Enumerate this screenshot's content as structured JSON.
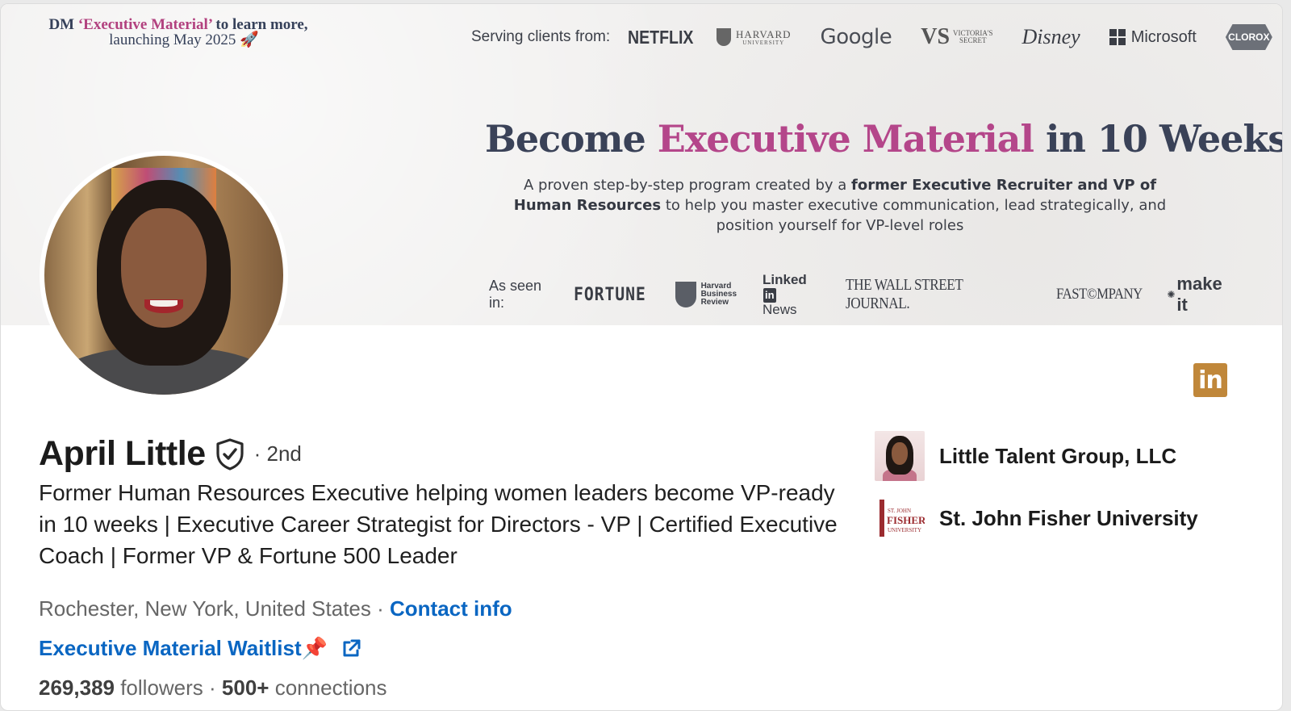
{
  "banner": {
    "dm_prefix": "DM ",
    "dm_highlight": "‘Executive Material’",
    "dm_suffix": " to learn more,",
    "dm_line2": "launching May 2025",
    "dm_emoji": "🚀",
    "serving_label": "Serving clients from:",
    "clients": {
      "netflix": "NETFLIX",
      "harvard_line1": "HARVARD",
      "harvard_line2": "UNIVERSITY",
      "google": "Google",
      "vs_line1": "VICTORIA'S",
      "vs_line2": "SECRET",
      "disney": "Disney",
      "microsoft": "Microsoft",
      "clorox": "CLOROX"
    },
    "headline_part1": "Become ",
    "headline_highlight": "Executive Material",
    "headline_part2": " in 10 Weeks",
    "sub_part1": "A proven step-by-step program created by a ",
    "sub_bold": "former Executive Recruiter and VP of Human Resources",
    "sub_part2": " to help you master executive communication, lead strategically, and position yourself for VP-level roles",
    "seen_label": "As seen in:",
    "media": {
      "fortune": "FORTUNE",
      "hbr_line1": "Harvard",
      "hbr_line2": "Business",
      "hbr_line3": "Review",
      "linkedin": "Linked",
      "linkedin_in": "in",
      "linkedin_news": "News",
      "wsj": "THE WALL STREET JOURNAL.",
      "fastcompany": "FAST©MPANY",
      "makeit": "make it"
    }
  },
  "badge": {
    "text": "in"
  },
  "profile": {
    "name": "April Little",
    "degree": "· 2nd",
    "headline": "Former Human Resources Executive helping women leaders become VP-ready in 10 weeks | Executive Career Strategist for Directors - VP | Certified Executive Coach | Former VP & Fortune 500 Leader",
    "location": "Rochester, New York, United States",
    "separator": " · ",
    "contact_info": "Contact info",
    "website_label": "Executive Material Waitlist📌",
    "followers_count": "269,389",
    "followers_label": " followers",
    "connections_sep": " · ",
    "connections_count": "500+",
    "connections_label": " connections"
  },
  "experience": [
    {
      "name": "Little Talent Group, LLC"
    },
    {
      "name": "St. John Fisher University",
      "logo_line1": "ST. JOHN",
      "logo_line2": "FISHER",
      "logo_line3": "UNIVERSITY"
    }
  ],
  "colors": {
    "accent_link": "#0a66c2",
    "headline_pink": "#b4468a",
    "badge_gold": "#c0873a"
  }
}
